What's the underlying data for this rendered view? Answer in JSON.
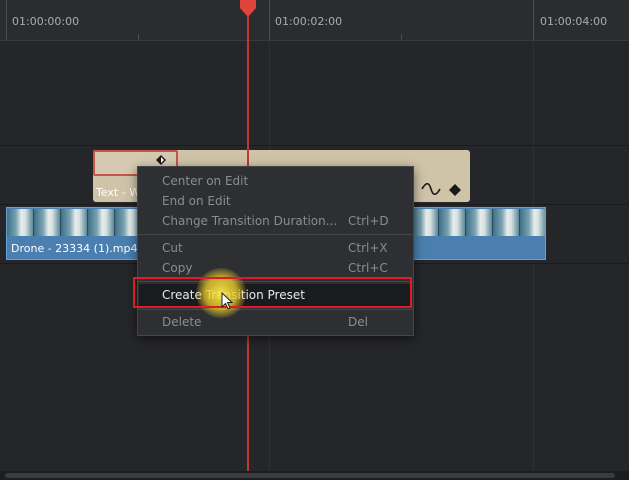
{
  "ruler": {
    "timecodes": [
      "01:00:00:00",
      "01:00:02:00",
      "01:00:04:00"
    ]
  },
  "clips": {
    "text_clip_title": "Text - W",
    "video_clip_title": "Drone - 23334 (1).mp4"
  },
  "context_menu": {
    "items": [
      {
        "label": "Center on Edit",
        "shortcut": ""
      },
      {
        "label": "End on Edit",
        "shortcut": ""
      },
      {
        "label": "Change Transition Duration...",
        "shortcut": "Ctrl+D"
      },
      {
        "label": "Cut",
        "shortcut": "Ctrl+X"
      },
      {
        "label": "Copy",
        "shortcut": "Ctrl+C"
      },
      {
        "label": "Create Transition Preset",
        "shortcut": ""
      },
      {
        "label": "Delete",
        "shortcut": "Del"
      }
    ]
  },
  "colors": {
    "playhead": "#c0392b",
    "video_clip": "#4a7fb0",
    "text_clip": "#cfc3a8",
    "highlight_box": "#e01a27"
  },
  "icons": [
    "playhead-icon",
    "keyframe-icon",
    "curve-icon",
    "cursor-icon"
  ]
}
